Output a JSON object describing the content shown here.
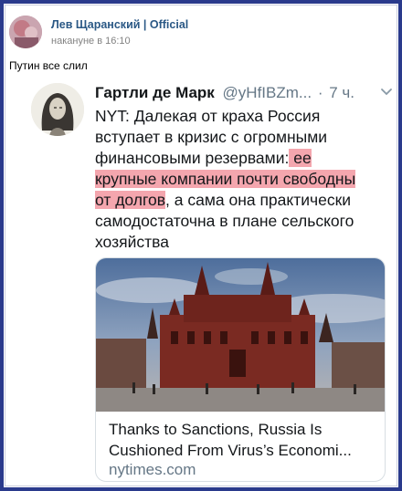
{
  "post": {
    "author": "Лев Щаранский | Official",
    "time": "накануне в 16:10",
    "text": "Путин все слил"
  },
  "tweet": {
    "name": "Гартли де Марк",
    "handle": "@yHfIBZm...",
    "dot": "·",
    "time": "7 ч.",
    "text_parts": {
      "p1": "NYT: Далекая от краха Россия вступает в кризис с огромными финансовыми резервами",
      "p2": ":",
      "hl1": " ее",
      "hl2": "крупные компании почти свободны",
      "hl3": "от долгов",
      "p3": ", а сама она практически самодостаточна в плане сельского хозяйства"
    },
    "highlight_color": "#f4a6ae"
  },
  "card": {
    "title_line1": "Thanks to Sanctions, Russia Is",
    "title_line2": "Cushioned From Virus’s Economi...",
    "domain": "nytimes.com",
    "image_icon": "moscow-historical-museum-photo"
  },
  "colors": {
    "frame": "#2a3a8c",
    "link": "#2a5885",
    "muted": "#657786"
  }
}
